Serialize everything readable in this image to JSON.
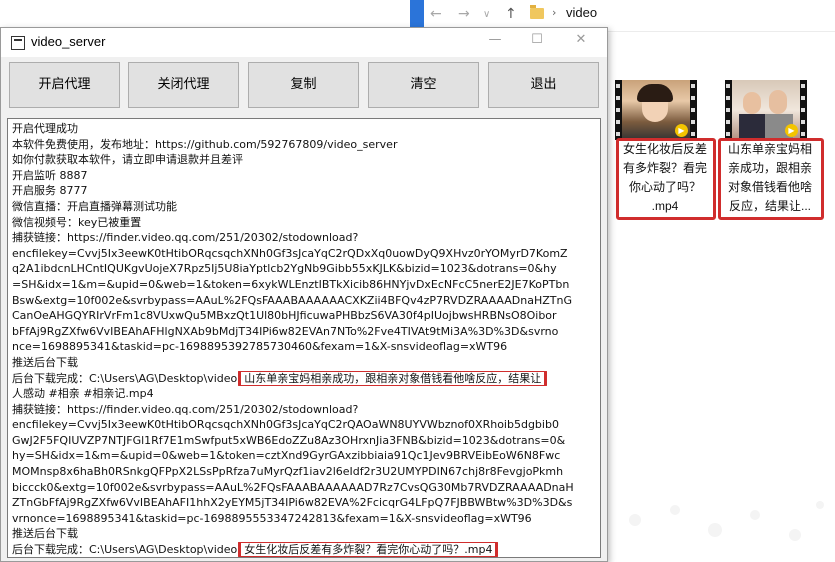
{
  "explorer": {
    "breadcrumb": "video",
    "files": [
      {
        "caption_lines": [
          "女生化妆后反差",
          "有多炸裂？看完",
          "你心动了吗？",
          ".mp4"
        ]
      },
      {
        "caption_lines": [
          "山东单亲宝妈相",
          "亲成功，跟相亲",
          "对象借钱看他啥",
          "反应，结果让..."
        ]
      }
    ]
  },
  "window": {
    "title": "video_server",
    "controls": {
      "minimize": "—",
      "maximize": "☐",
      "close": "✕"
    }
  },
  "toolbar": {
    "buttons": [
      "开启代理",
      "关闭代理",
      "复制",
      "清空",
      "退出"
    ]
  },
  "log": {
    "lines": [
      "开启代理成功",
      "本软件免费使用，发布地址：https://github.com/592767809/video_server",
      "如你付款获取本软件，请立即申请退款并且差评",
      "开启监听 8887",
      "开启服务 8777",
      "微信直播：开启直播弹幕测试功能",
      "微信视频号：key已被重置",
      "捕获链接：https://finder.video.qq.com/251/20302/stodownload?",
      "encfilekey=Cvvj5Ix3eewK0tHtibORqcsqchXNh0Gf3sJcaYqC2rQDxXq0uowDyQ9XHvz0rYOMyrD7KomZ",
      "q2A1ibdcnLHCntIQUKgvUojeX7Rpz5Ij5U8iaYptlcb2YgNb9Gibb55xKJLK&bizid=1023&dotrans=0&hy",
      "=SH&idx=1&m=&upid=0&web=1&token=6xykWLEnztIBTkXicib86HNYjvDxEcNFcC5nerE2JE7KoPTbn",
      "Bsw&extg=10f002e&svrbypass=AAuL%2FQsFAAABAAAAAACXKZii4BFQv4zP7RVDZRAAAADnaHZTnG",
      "CanOeAHGQYRIrVrFm1c8VUxwQu5MBxzQt1Ul80bHJficuwaPHBbzS6VA30f4pIUojbwsHRBNsO8Oibor",
      "bFfAj9RgZXfw6VvIBEAhAFHlgNXAb9bMdjT34IPi6w82EVAn7NTo%2Fve4TIVAt9tMi3A%3D%3D&svrno",
      "nce=1698895341&taskid=pc-1698895392785730460&fexam=1&X-snsvideoflag=xWT96",
      "推送后台下载"
    ],
    "download_label": "后台下载完成：",
    "download_path": "C:\\Users\\AG\\Desktop\\video",
    "download1_name_a": "山东单亲宝妈相亲成功，跟相亲对象借钱看他啥反应，结果让",
    "download1_name_b": "人感动 #相亲 #相亲记.mp4",
    "lines2": [
      "捕获链接：https://finder.video.qq.com/251/20302/stodownload?",
      "encfilekey=Cvvj5Ix3eewK0tHtibORqcsqchXNh0Gf3sJcaYqC2rQAOaWN8UYVWbznof0XRhoib5dgbib0",
      "GwJ2F5FQIUVZP7NTJFGl1Rf7E1mSwfput5xWB6EdoZZu8Az3OHrxnJia3FNB&bizid=1023&dotrans=0&",
      "hy=SH&idx=1&m=&upid=0&web=1&token=cztXnd9GyrGAxzibbiaia91Qc1Jev9BRVEibEoW6N8Fwc",
      "MOMnsp8x6haBh0RSnkgQFPpX2LSsPpRfza7uMyrQzf1iav2l6eIdf2r3U2UMYPDIN67chj8r8FevgjoPkmh",
      "biccck0&extg=10f002e&svrbypass=AAuL%2FQsFAAABAAAAAAD7Rz7CvsQG30Mb7RVDZRAAAADnaH",
      "ZTnGbFfAj9RgZXfw6VvIBEAhAFI1hhX2yEYM5jT34IPi6w82EVA%2FcicqrG4LFpQ7FJBBWBtw%3D%3D&s",
      "vrnonce=1698895341&taskid=pc-1698895553347242813&fexam=1&X-snsvideoflag=xWT96",
      "推送后台下载"
    ],
    "download2_name": "女生化妆后反差有多炸裂？看完你心动了吗？.mp4"
  },
  "colors": {
    "highlight_border": "#d02d2d",
    "title_bar": "#ffffff",
    "button_face": "#e1e1e1"
  }
}
